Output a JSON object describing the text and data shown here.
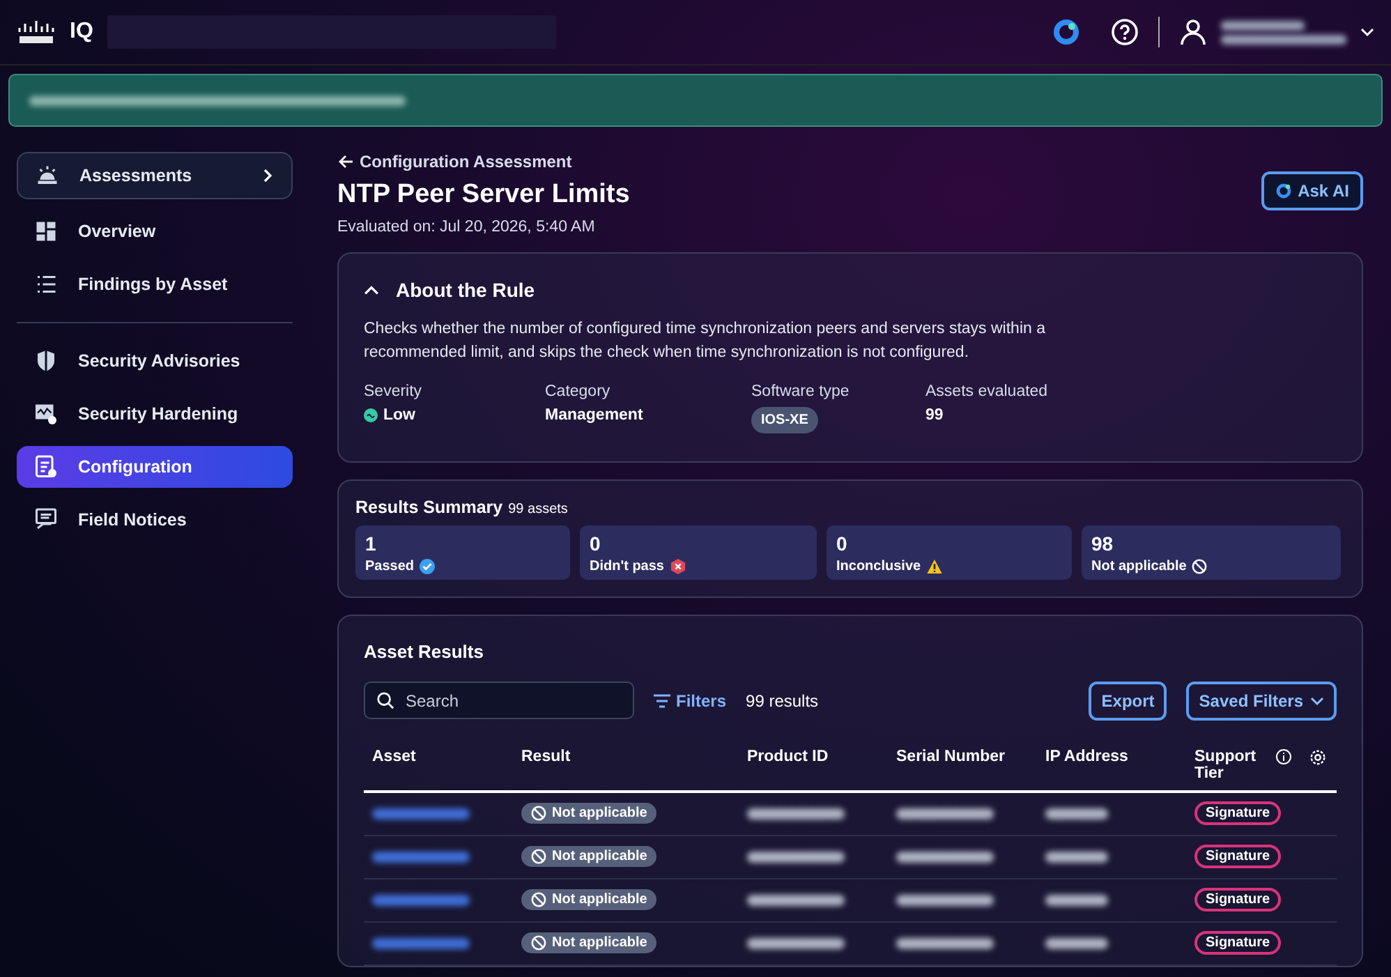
{
  "header": {
    "product": "IQ"
  },
  "sidebar": {
    "items": [
      {
        "label": "Assessments",
        "kind": "group",
        "selected": false
      },
      {
        "label": "Overview",
        "kind": "item",
        "selected": false
      },
      {
        "label": "Findings by Asset",
        "kind": "item",
        "selected": false
      },
      {
        "label": "Security Advisories",
        "kind": "item",
        "selected": false
      },
      {
        "label": "Security Hardening",
        "kind": "item",
        "selected": false
      },
      {
        "label": "Configuration",
        "kind": "item",
        "selected": true
      },
      {
        "label": "Field Notices",
        "kind": "item",
        "selected": false
      }
    ]
  },
  "page": {
    "back_link": "Configuration Assessment",
    "title": "NTP Peer Server Limits",
    "evaluated": "Evaluated on: Jul 20, 2026, 5:40 AM",
    "ask_button": "Ask AI"
  },
  "about": {
    "title": "About the Rule",
    "expanded": true,
    "description": "Checks whether the number of configured time synchronization peers and servers stays within a recommended limit, and skips the check when time synchronization is not configured.",
    "fields": [
      {
        "label": "Severity",
        "value": "Low",
        "kind": "severity"
      },
      {
        "label": "Category",
        "value": "Management",
        "kind": "text"
      },
      {
        "label": "Software type",
        "value": "IOS-XE",
        "kind": "tag"
      },
      {
        "label": "Assets evaluated",
        "value": "99",
        "kind": "text"
      }
    ]
  },
  "summary": {
    "title": "Results Summary",
    "count": "99 assets",
    "cards": [
      {
        "value": "1",
        "label": "Passed",
        "kind": "passed"
      },
      {
        "value": "0",
        "label": "Didn't pass",
        "kind": "failed"
      },
      {
        "value": "0",
        "label": "Inconclusive",
        "kind": "inconclusive"
      },
      {
        "value": "98",
        "label": "Not applicable",
        "kind": "na"
      }
    ]
  },
  "results": {
    "title": "Asset Results",
    "search_placeholder": "Search",
    "filters": "Filters",
    "count": "99 results",
    "export": "Export",
    "saved_filters": "Saved Filters",
    "columns": [
      "Asset",
      "Result",
      "Product ID",
      "Serial Number",
      "IP Address",
      "Support Tier"
    ],
    "rows": [
      {
        "result": "Not applicable",
        "tier": "Signature"
      },
      {
        "result": "Not applicable",
        "tier": "Signature"
      },
      {
        "result": "Not applicable",
        "tier": "Signature"
      },
      {
        "result": "Not applicable",
        "tier": "Signature"
      }
    ]
  }
}
